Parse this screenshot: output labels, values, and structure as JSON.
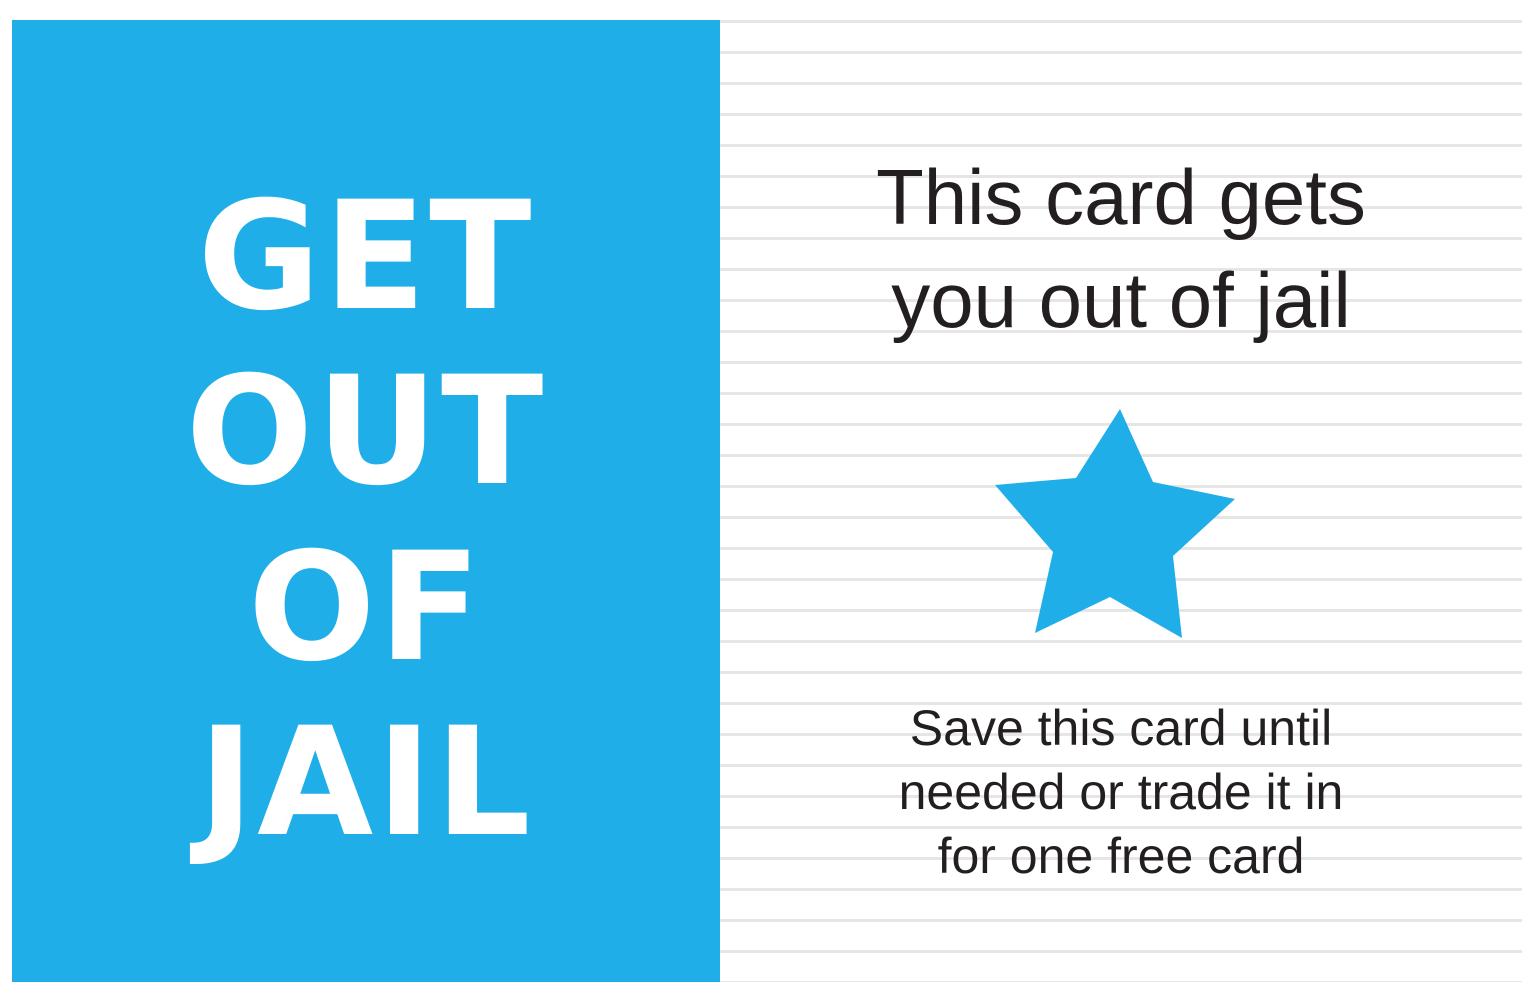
{
  "colors": {
    "accent": "#20aee8",
    "text": "#231f20",
    "stripe": "#e6e6e6",
    "background": "#ffffff"
  },
  "left_panel": {
    "title_lines": [
      "GET",
      "OUT",
      "OF",
      "JAIL"
    ]
  },
  "right_panel": {
    "headline_lines": [
      "This card gets",
      "you out of jail"
    ],
    "icon": "star-icon",
    "note_lines": [
      "Save this card until",
      "needed or trade it in",
      "for one free card"
    ]
  }
}
